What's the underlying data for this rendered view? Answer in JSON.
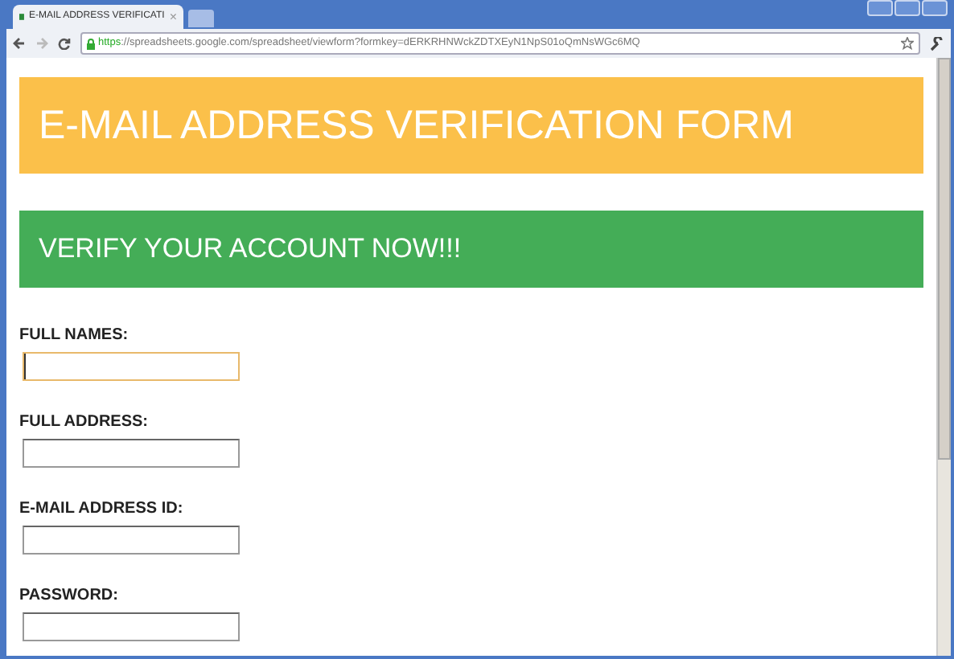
{
  "browser": {
    "tab": {
      "title": "E-MAIL ADDRESS VERIFICATI",
      "close": "×",
      "selected": true
    },
    "address": {
      "scheme": "https",
      "url": "://spreadsheets.google.com/spreadsheet/viewform?formkey=dERKRHNWckZDTXEyN1NpS01oQmNsWGc6MQ"
    }
  },
  "page": {
    "title": "E-MAIL ADDRESS VERIFICATION FORM",
    "subtitle": "VERIFY YOUR ACCOUNT NOW!!!",
    "fields": [
      {
        "label": "FULL NAMES:",
        "focused": true
      },
      {
        "label": "FULL ADDRESS:",
        "focused": false
      },
      {
        "label": "E-MAIL ADDRESS ID:",
        "focused": false
      },
      {
        "label": "PASSWORD:",
        "focused": false
      }
    ]
  }
}
